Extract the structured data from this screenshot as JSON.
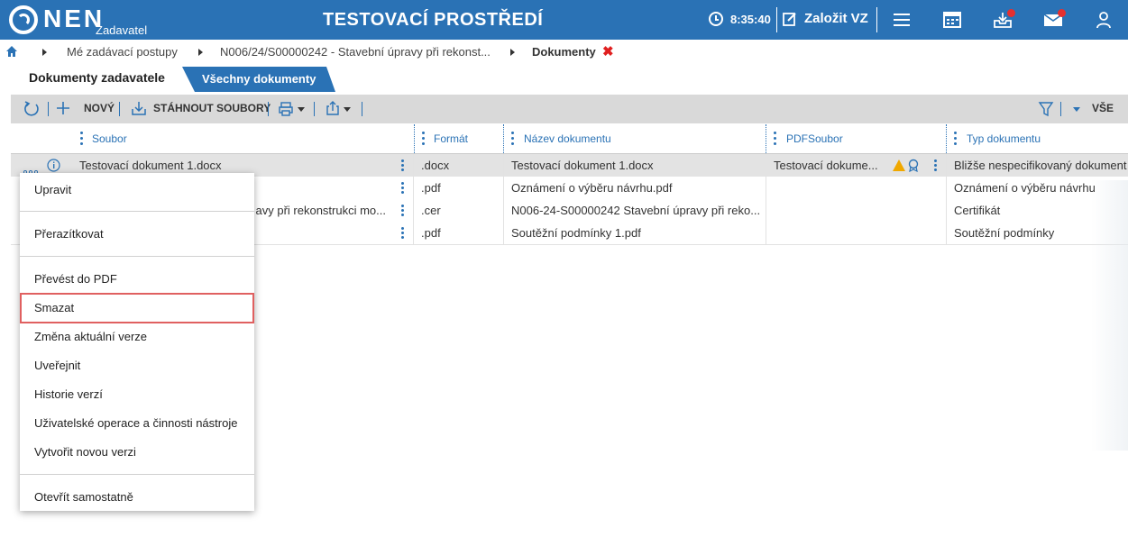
{
  "header": {
    "logo_text": "NEN",
    "logo_sub": "Zadavatel",
    "env_title": "TESTOVACÍ PROSTŘEDÍ",
    "clock": "8:35:40",
    "create_label": "Založit VZ",
    "icons": [
      "clock-icon",
      "edit-icon",
      "menu-icon",
      "calendar-icon",
      "inbox-icon",
      "mail-icon",
      "user-icon"
    ],
    "brand_color": "#2a72b5",
    "notification_color": "#e53030"
  },
  "breadcrumb": {
    "items": [
      "Mé zadávací postupy",
      "N006/24/S00000242 - Stavební úpravy při rekonst...",
      "Dokumenty"
    ]
  },
  "tabs": {
    "active": "Dokumenty zadavatele",
    "other": "Všechny dokumenty"
  },
  "toolbar": {
    "new_label": "NOVÝ",
    "download_label": "STÁHNOUT SOUBORY",
    "filter_label": "VŠE"
  },
  "grid": {
    "columns": [
      "Soubor",
      "Formát",
      "Název dokumentu",
      "PDFSoubor",
      "Typ dokumentu"
    ],
    "rows": [
      {
        "soubor": "Testovací dokument 1.docx",
        "format": ".docx",
        "nazev": "Testovací dokument 1.docx",
        "pdf": "Testovací dokume...",
        "typ": "Bližše nespecifikovaný dokument"
      },
      {
        "soubor": "",
        "format": ".pdf",
        "nazev": "Oznámení o výběru návrhu.pdf",
        "pdf": "",
        "typ": "Oznámení o výběru návrhu"
      },
      {
        "soubor": "avy při rekonstrukci mo...",
        "format": ".cer",
        "nazev": "N006-24-S00000242 Stavební úpravy při reko...",
        "pdf": "",
        "typ": "Certifikát"
      },
      {
        "soubor": "",
        "format": ".pdf",
        "nazev": "Soutěžní podmínky 1.pdf",
        "pdf": "",
        "typ": "Soutěžní podmínky"
      }
    ]
  },
  "context_menu": {
    "items": [
      "Upravit",
      "Přerazítkovat",
      "Převést do PDF",
      "Smazat",
      "Změna aktuální verze",
      "Uveřejnit",
      "Historie verzí",
      "Uživatelské operace a činnosti nástroje",
      "Vytvořit novou verzi",
      "Otevřít samostatně"
    ],
    "highlighted": "Smazat"
  }
}
